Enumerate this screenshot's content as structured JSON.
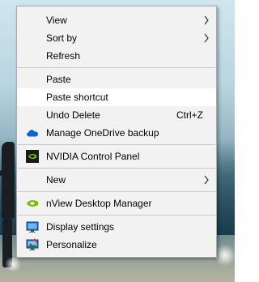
{
  "menu": {
    "view": "View",
    "sort_by": "Sort by",
    "refresh": "Refresh",
    "paste": "Paste",
    "paste_shortcut": "Paste shortcut",
    "undo_delete": "Undo Delete",
    "undo_shortcut": "Ctrl+Z",
    "manage_onedrive": "Manage OneDrive backup",
    "nvidia_panel": "NVIDIA Control Panel",
    "new": "New",
    "nview": "nView Desktop Manager",
    "display_settings": "Display settings",
    "personalize": "Personalize"
  },
  "icons": {
    "onedrive": "onedrive-cloud-icon",
    "nvidia": "nvidia-icon",
    "nview": "nview-icon",
    "display": "display-icon",
    "personalize": "personalize-icon"
  },
  "colors": {
    "menu_bg": "#f2f2f2",
    "hover_bg": "#ffffff",
    "separator": "#c8c8c8",
    "nvidia_green": "#76b900",
    "onedrive_blue": "#0a64d2"
  }
}
